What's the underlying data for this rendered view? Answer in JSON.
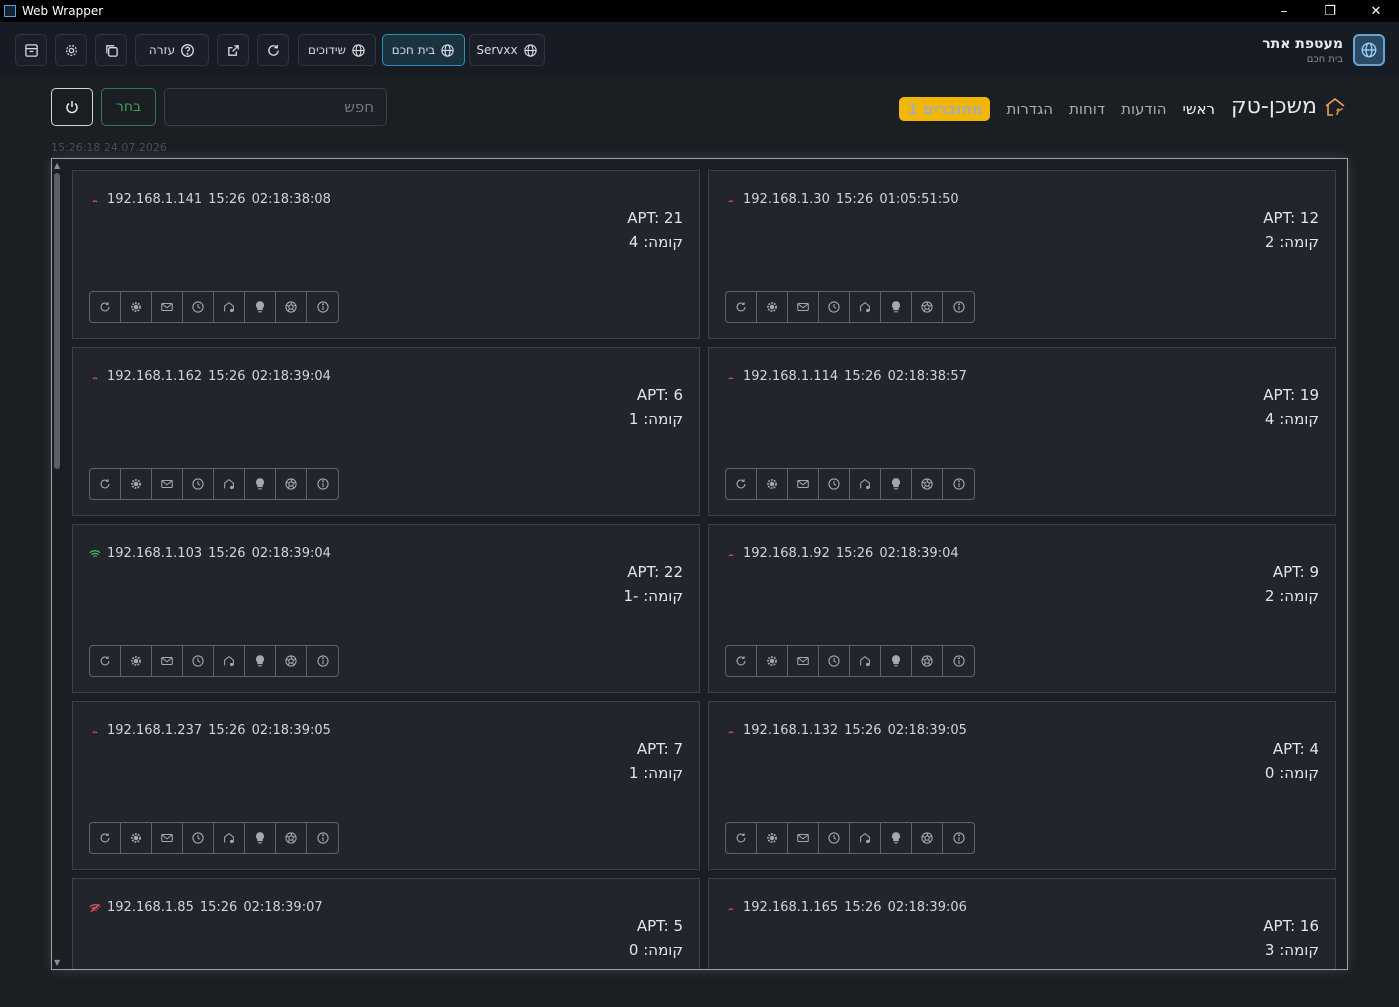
{
  "window": {
    "title": "Web Wrapper",
    "controls": [
      "–",
      "❐",
      "✕"
    ]
  },
  "toolbar": {
    "brand_name": "מעטפת אתר",
    "brand_sub": "בית חכם",
    "help_label": "עזרה",
    "tabs": [
      {
        "label": "Servxx",
        "active": false
      },
      {
        "label": "בית חכם",
        "active": true
      },
      {
        "label": "שידוכים",
        "active": false
      }
    ]
  },
  "header": {
    "logo_text": "משכן-טק",
    "nav": [
      "ראשי",
      "הודעות",
      "דוחות",
      "הגדרות"
    ],
    "connected_badge": "1 מחוברים",
    "search_placeholder": "חפש",
    "choose_label": "בחר",
    "timestamp": "15:26:18 24.07.2026"
  },
  "colors": {
    "accent_active": "#2e8fb5",
    "badge": "#f2b705",
    "ok": "#3fbf6a",
    "bad": "#e0525a",
    "choose": "#3f9d5e"
  },
  "devices": [
    {
      "ip": "192.168.1.30",
      "time": "15:26",
      "uptime": "01:05:51:50",
      "apt": "APT: 12",
      "floor": "קומה: 2",
      "signal": "weak"
    },
    {
      "ip": "192.168.1.141",
      "time": "15:26",
      "uptime": "02:18:38:08",
      "apt": "APT: 21",
      "floor": "קומה: 4",
      "signal": "weak"
    },
    {
      "ip": "192.168.1.114",
      "time": "15:26",
      "uptime": "02:18:38:57",
      "apt": "APT: 19",
      "floor": "קומה: 4",
      "signal": "weak"
    },
    {
      "ip": "192.168.1.162",
      "time": "15:26",
      "uptime": "02:18:39:04",
      "apt": "APT: 6",
      "floor": "קומה: 1",
      "signal": "weak"
    },
    {
      "ip": "192.168.1.92",
      "time": "15:26",
      "uptime": "02:18:39:04",
      "apt": "APT: 9",
      "floor": "קומה: 2",
      "signal": "weak"
    },
    {
      "ip": "192.168.1.103",
      "time": "15:26",
      "uptime": "02:18:39:04",
      "apt": "APT: 22",
      "floor": "קומה: -1",
      "signal": "strong"
    },
    {
      "ip": "192.168.1.132",
      "time": "15:26",
      "uptime": "02:18:39:05",
      "apt": "APT: 4",
      "floor": "קומה: 0",
      "signal": "weak"
    },
    {
      "ip": "192.168.1.237",
      "time": "15:26",
      "uptime": "02:18:39:05",
      "apt": "APT: 7",
      "floor": "קומה: 1",
      "signal": "weak"
    },
    {
      "ip": "192.168.1.165",
      "time": "15:26",
      "uptime": "02:18:39:06",
      "apt": "APT: 16",
      "floor": "קומה: 3",
      "signal": "weak"
    },
    {
      "ip": "192.168.1.85",
      "time": "15:26",
      "uptime": "02:18:39:07",
      "apt": "APT: 5",
      "floor": "קומה: 0",
      "signal": "offline"
    }
  ],
  "card_actions": [
    "refresh-icon",
    "gear-icon",
    "mail-icon",
    "clock-icon",
    "home-icon",
    "bulb-icon",
    "aperture-icon",
    "info-icon"
  ]
}
